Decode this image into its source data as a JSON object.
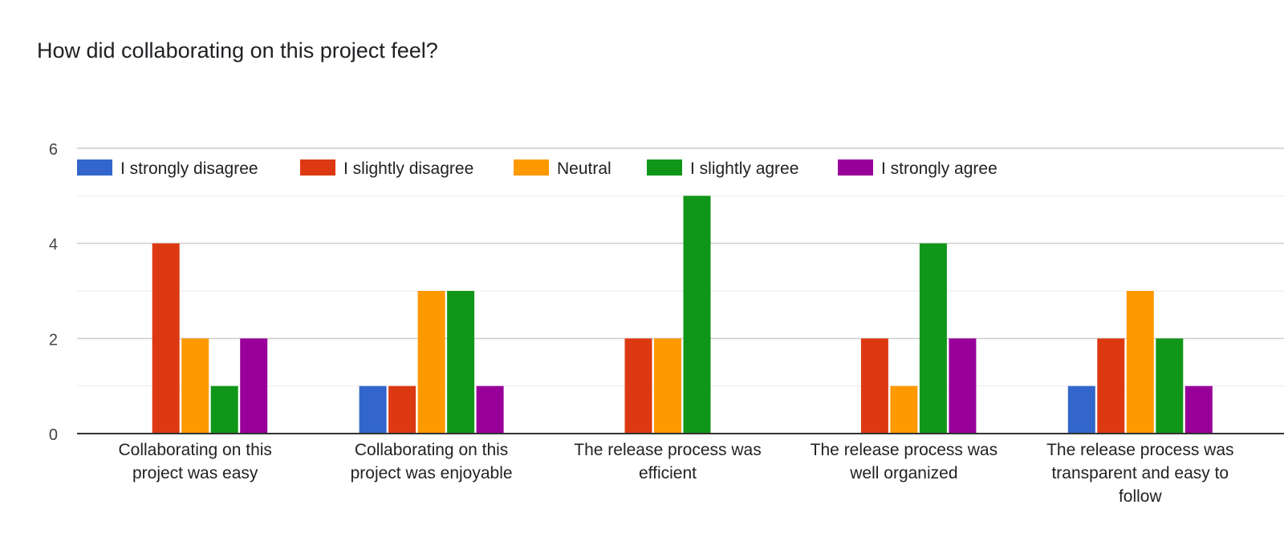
{
  "chart_data": {
    "type": "bar",
    "title": "How did collaborating on this project feel?",
    "xlabel": "",
    "ylabel": "",
    "ylim": [
      0,
      6
    ],
    "yticks": [
      0,
      2,
      4,
      6
    ],
    "grid": true,
    "legend_position": "top",
    "categories": [
      [
        "Collaborating on this",
        "project was easy"
      ],
      [
        "Collaborating on this",
        "project was enjoyable"
      ],
      [
        "The release process was",
        "efficient"
      ],
      [
        "The release process was",
        "well organized"
      ],
      [
        "The release process was",
        "transparent and easy to",
        "follow"
      ]
    ],
    "series": [
      {
        "name": "I strongly disagree",
        "color": "#3366cc",
        "values": [
          0,
          1,
          0,
          0,
          1
        ]
      },
      {
        "name": "I slightly disagree",
        "color": "#dc3912",
        "values": [
          4,
          1,
          2,
          2,
          2
        ]
      },
      {
        "name": "Neutral",
        "color": "#ff9900",
        "values": [
          2,
          3,
          2,
          1,
          3
        ]
      },
      {
        "name": "I slightly agree",
        "color": "#109618",
        "values": [
          1,
          3,
          5,
          4,
          2
        ]
      },
      {
        "name": "I strongly agree",
        "color": "#990099",
        "values": [
          2,
          1,
          0,
          2,
          1
        ]
      }
    ]
  }
}
